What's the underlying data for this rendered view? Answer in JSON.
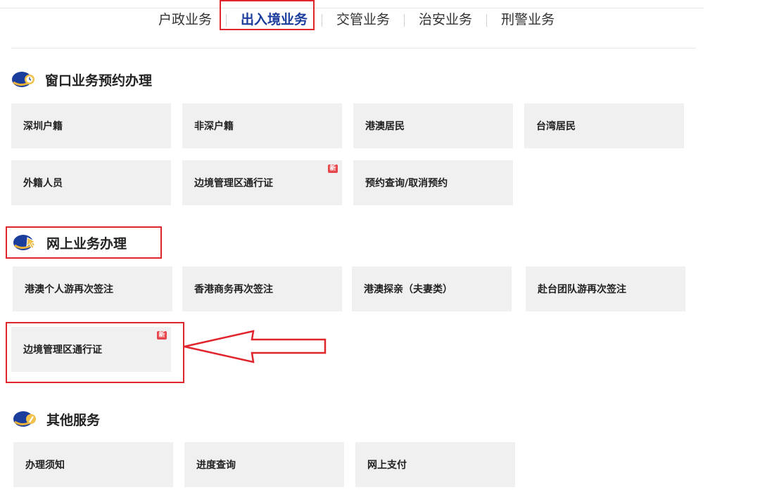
{
  "tabs": [
    {
      "label": "户政业务"
    },
    {
      "label": "出入境业务"
    },
    {
      "label": "交管业务"
    },
    {
      "label": "治安业务"
    },
    {
      "label": "刑警业务"
    }
  ],
  "sections": {
    "window": {
      "title": "窗口业务预约办理",
      "icon": "clock-badge-icon",
      "items": [
        {
          "label": "深圳户籍"
        },
        {
          "label": "非深户籍"
        },
        {
          "label": "港澳居民"
        },
        {
          "label": "台湾居民"
        },
        {
          "label": "外籍人员"
        },
        {
          "label": "边境管理区通行证",
          "badge": "新"
        },
        {
          "label": "预约查询/取消预约"
        }
      ]
    },
    "online": {
      "title": "网上业务办理",
      "icon": "cursor-badge-icon",
      "items": [
        {
          "label": "港澳个人游再次签注"
        },
        {
          "label": "香港商务再次签注"
        },
        {
          "label": "港澳探亲（夫妻类）"
        },
        {
          "label": "赴台团队游再次签注"
        },
        {
          "label": "边境管理区通行证",
          "badge": "新"
        }
      ]
    },
    "other": {
      "title": "其他服务",
      "icon": "pen-badge-icon",
      "items": [
        {
          "label": "办理须知"
        },
        {
          "label": "进度查询"
        },
        {
          "label": "网上支付"
        }
      ]
    }
  },
  "colors": {
    "accent": "#1b3d9c",
    "highlight": "#e0262c",
    "card_bg": "#f0f0f0",
    "badge": "#e8464a"
  }
}
